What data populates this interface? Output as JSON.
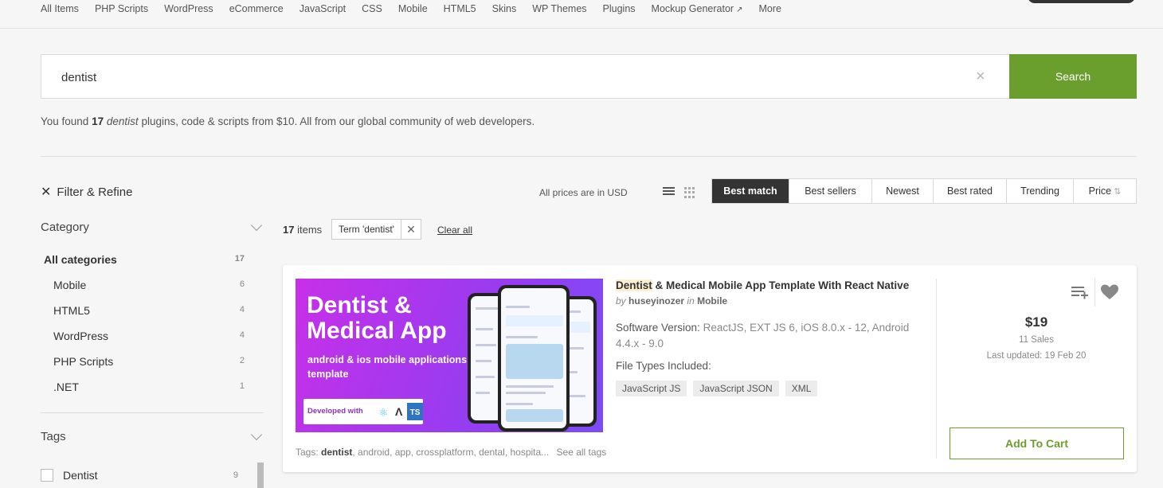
{
  "top_nav": {
    "items": [
      "All Items",
      "PHP Scripts",
      "WordPress",
      "eCommerce",
      "JavaScript",
      "CSS",
      "Mobile",
      "HTML5",
      "Skins",
      "WP Themes",
      "Plugins",
      "Mockup Generator",
      "More"
    ]
  },
  "search": {
    "value": "dentist",
    "button_label": "Search"
  },
  "results_summary": {
    "prefix": "You found",
    "count": "17",
    "term": "dentist",
    "suffix": "plugins, code & scripts from $10. All from our global community of web developers."
  },
  "filter": {
    "title": "Filter & Refine",
    "category_title": "Category",
    "categories": [
      {
        "label": "All categories",
        "count": "17"
      },
      {
        "label": "Mobile",
        "count": "6"
      },
      {
        "label": "HTML5",
        "count": "4"
      },
      {
        "label": "WordPress",
        "count": "4"
      },
      {
        "label": "PHP Scripts",
        "count": "2"
      },
      {
        "label": ".NET",
        "count": "1"
      }
    ],
    "tags_title": "Tags",
    "tags": [
      {
        "label": "Dentist",
        "count": "9"
      }
    ]
  },
  "sort": {
    "prices_note": "All prices are in USD",
    "options": [
      "Best match",
      "Best sellers",
      "Newest",
      "Best rated",
      "Trending",
      "Price"
    ],
    "active": "Best match"
  },
  "items_bar": {
    "count": "17",
    "label": "items",
    "term_chip": "Term 'dentist'",
    "clear_all": "Clear all"
  },
  "product": {
    "thumb_heading": "Dentist & Medical App",
    "thumb_sub": "android & ios mobile applications template",
    "thumb_dev": "Developed with",
    "thumb_ts": "TS",
    "title_highlight": "Dentist",
    "title_rest": " & Medical Mobile App Template With React Native",
    "by_prefix": "by",
    "author": "huseyinozer",
    "in_word": "in",
    "category": "Mobile",
    "software_label": "Software Version:",
    "software_value": "ReactJS, EXT JS 6, iOS 8.0.x - 12, Android 4.4.x - 9.0",
    "file_types_label": "File Types Included:",
    "file_types": [
      "JavaScript JS",
      "JavaScript JSON",
      "XML"
    ],
    "tags_label": "Tags:",
    "tags_bold": "dentist",
    "tags_rest": ", android, app, crossplatform, dental, hospita...",
    "see_all_tags": "See all tags",
    "price": "$19",
    "sales": "11 Sales",
    "last_updated": "Last updated: 19 Feb 20",
    "cart_label": "Add To Cart"
  },
  "colors": {
    "accent": "#6a9e2d",
    "active_sort": "#333333"
  }
}
